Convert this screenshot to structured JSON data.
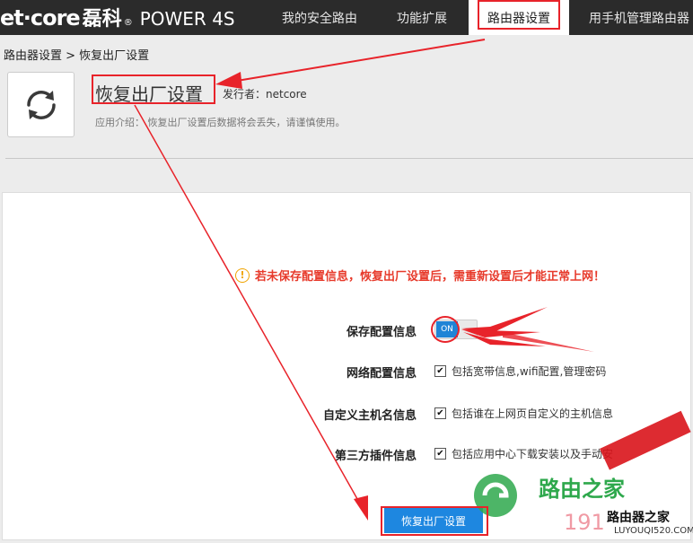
{
  "brand": {
    "logo_main": "et·core",
    "logo_cn": "磊科",
    "logo_reg": "®",
    "model": "POWER 4S"
  },
  "nav": {
    "items": [
      {
        "label": "我的安全路由"
      },
      {
        "label": "功能扩展"
      },
      {
        "label": "路由器设置"
      },
      {
        "label": "用手机管理路由器"
      }
    ],
    "active_index": 2
  },
  "breadcrumb": "路由器设置 > 恢复出厂设置",
  "plugin": {
    "icon": "refresh-icon",
    "title": "恢复出厂设置",
    "publisher": "发行者：netcore",
    "description": "应用介绍：  恢复出厂设置后数据将会丢失，请谨慎使用。"
  },
  "warning": {
    "icon": "exclamation-circle-icon",
    "text": "若未保存配置信息，恢复出厂设置后，需重新设置后才能正常上网！"
  },
  "options": [
    {
      "label": "保存配置信息",
      "type": "toggle",
      "value": "ON"
    },
    {
      "label": "网络配置信息",
      "checked": true,
      "desc": "包括宽带信息,wifi配置,管理密码"
    },
    {
      "label": "自定义主机名信息",
      "checked": true,
      "desc": "包括谁在上网页自定义的主机信息"
    },
    {
      "label": "第三方插件信息",
      "checked": true,
      "desc": "包括应用中心下载安装以及手动安"
    }
  ],
  "reset_button": "恢复出厂设置",
  "watermark": {
    "text1": "路由之家",
    "text2": "191",
    "text3": "路由器之家",
    "text4": "LUYOUQI520.COM"
  },
  "colors": {
    "topbar": "#2b2b2b",
    "accent": "#1e87e0",
    "warning": "#e73a2b",
    "annotation": "#e8232a"
  }
}
